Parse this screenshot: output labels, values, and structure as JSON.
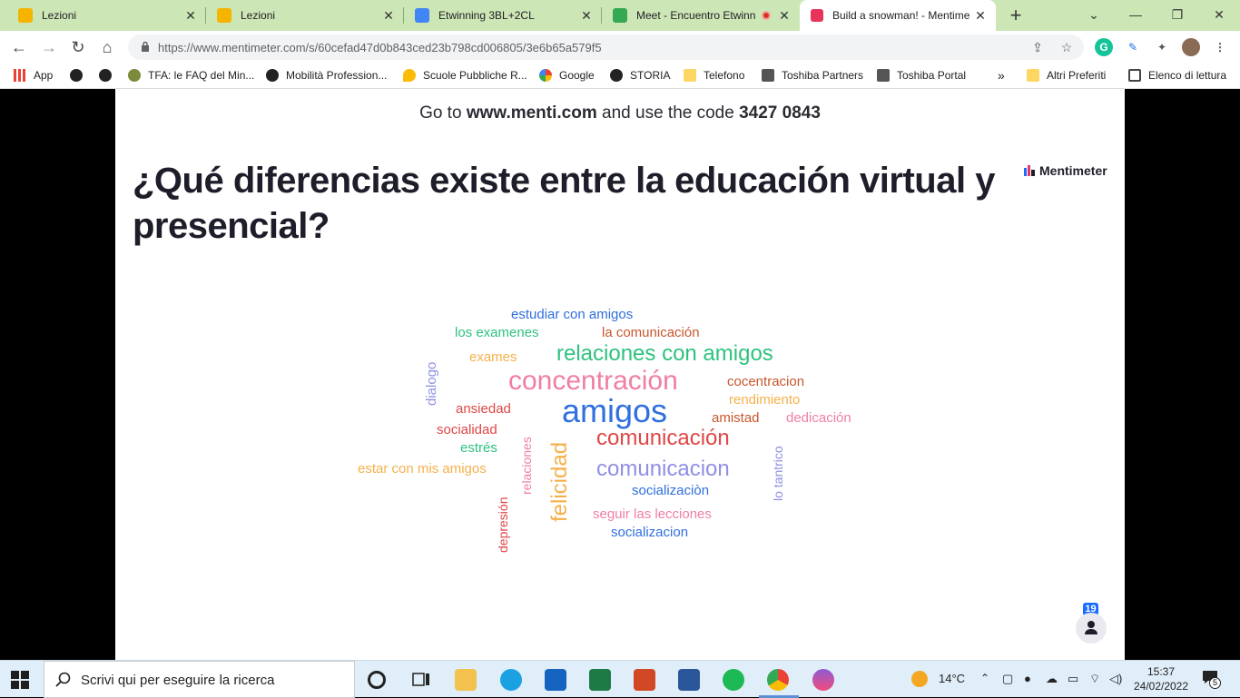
{
  "tabs": [
    {
      "title": "Lezioni",
      "color": "#f4b400"
    },
    {
      "title": "Lezioni",
      "color": "#f4b400"
    },
    {
      "title": "Etwinning 3BL+2CL",
      "color": "#4285f4"
    },
    {
      "title": "Meet - Encuentro Etwinn",
      "color": "#34a853"
    },
    {
      "title": "Build a snowman! - Mentime",
      "color": "#e8335a"
    }
  ],
  "tab_close": "✕",
  "new_tab": "+",
  "window": {
    "minimize": "⌄",
    "restore": "—",
    "maximize": "❐",
    "close": "✕"
  },
  "nav": {
    "back": "←",
    "forward": "→",
    "reload": "↻",
    "home": "⌂"
  },
  "address": {
    "url": "https://www.mentimeter.com/s/60cefad47d0b843ced23b798cd006805/3e6b65a579f5"
  },
  "bookmarks": [
    {
      "label": "App",
      "icon": "apps-icon"
    },
    {
      "label": "",
      "icon": "globe-icon"
    },
    {
      "label": "",
      "icon": "globe-icon"
    },
    {
      "label": "TFA: le FAQ del Min...",
      "icon": "tfa-icon"
    },
    {
      "label": "Mobilità Profession...",
      "icon": "globe-icon"
    },
    {
      "label": "Scuole Pubbliche R...",
      "icon": "pin-icon"
    },
    {
      "label": "Google",
      "icon": "google-icon"
    },
    {
      "label": "STORIA",
      "icon": "globe-icon"
    },
    {
      "label": "Telefono",
      "icon": "folder-icon"
    },
    {
      "label": "Toshiba Partners",
      "icon": "toshiba-icon"
    },
    {
      "label": "Toshiba Portal",
      "icon": "toshiba-icon"
    }
  ],
  "bookmarks_more": "»",
  "other_bookmarks": "Altri Preferiti",
  "reading_list": "Elenco di lettura",
  "slide": {
    "join_prefix": "Go to ",
    "join_site": "www.menti.com",
    "join_mid": " and use the code ",
    "join_code": "3427 0843",
    "question": "¿Qué diferencias existe entre la educación virtual y presencial?",
    "brand": "Mentimeter",
    "participants": "19"
  },
  "wordcloud": [
    {
      "text": "estudiar con amigos",
      "color": "#2f6fde"
    },
    {
      "text": "los examenes",
      "color": "#2ec27e"
    },
    {
      "text": "la comunicación",
      "color": "#c8562c"
    },
    {
      "text": "relaciones con amigos",
      "color": "#2ec27e"
    },
    {
      "text": "exames",
      "color": "#f5b04a"
    },
    {
      "text": "dialogo",
      "color": "#8f8fe6"
    },
    {
      "text": "concentración",
      "color": "#f07fa2"
    },
    {
      "text": "cocentracion",
      "color": "#c8562c"
    },
    {
      "text": "rendimiento",
      "color": "#f5b04a"
    },
    {
      "text": "ansiedad",
      "color": "#e04646"
    },
    {
      "text": "amigos",
      "color": "#2f6fde"
    },
    {
      "text": "amistad",
      "color": "#c8562c"
    },
    {
      "text": "dedicación",
      "color": "#f07fa2"
    },
    {
      "text": "socialidad",
      "color": "#e04646"
    },
    {
      "text": "relaciones",
      "color": "#f07fa2"
    },
    {
      "text": "felicidad",
      "color": "#f5b04a"
    },
    {
      "text": "comunicación",
      "color": "#e04646"
    },
    {
      "text": "estrés",
      "color": "#2ec27e"
    },
    {
      "text": "lo tantrico",
      "color": "#8f8fe6"
    },
    {
      "text": "estar con mis amigos",
      "color": "#f5b04a"
    },
    {
      "text": "comunicacion",
      "color": "#8f8fe6"
    },
    {
      "text": "socializaciòn",
      "color": "#2f6fde"
    },
    {
      "text": "depresión",
      "color": "#e04646"
    },
    {
      "text": "seguir las lecciones",
      "color": "#f07fa2"
    },
    {
      "text": "socializacion",
      "color": "#2f6fde"
    }
  ],
  "taskbar": {
    "search_placeholder": "Scrivi qui per eseguire la ricerca",
    "weather": "14°C",
    "time": "15:37",
    "date": "24/02/2022",
    "notifications": "5"
  }
}
